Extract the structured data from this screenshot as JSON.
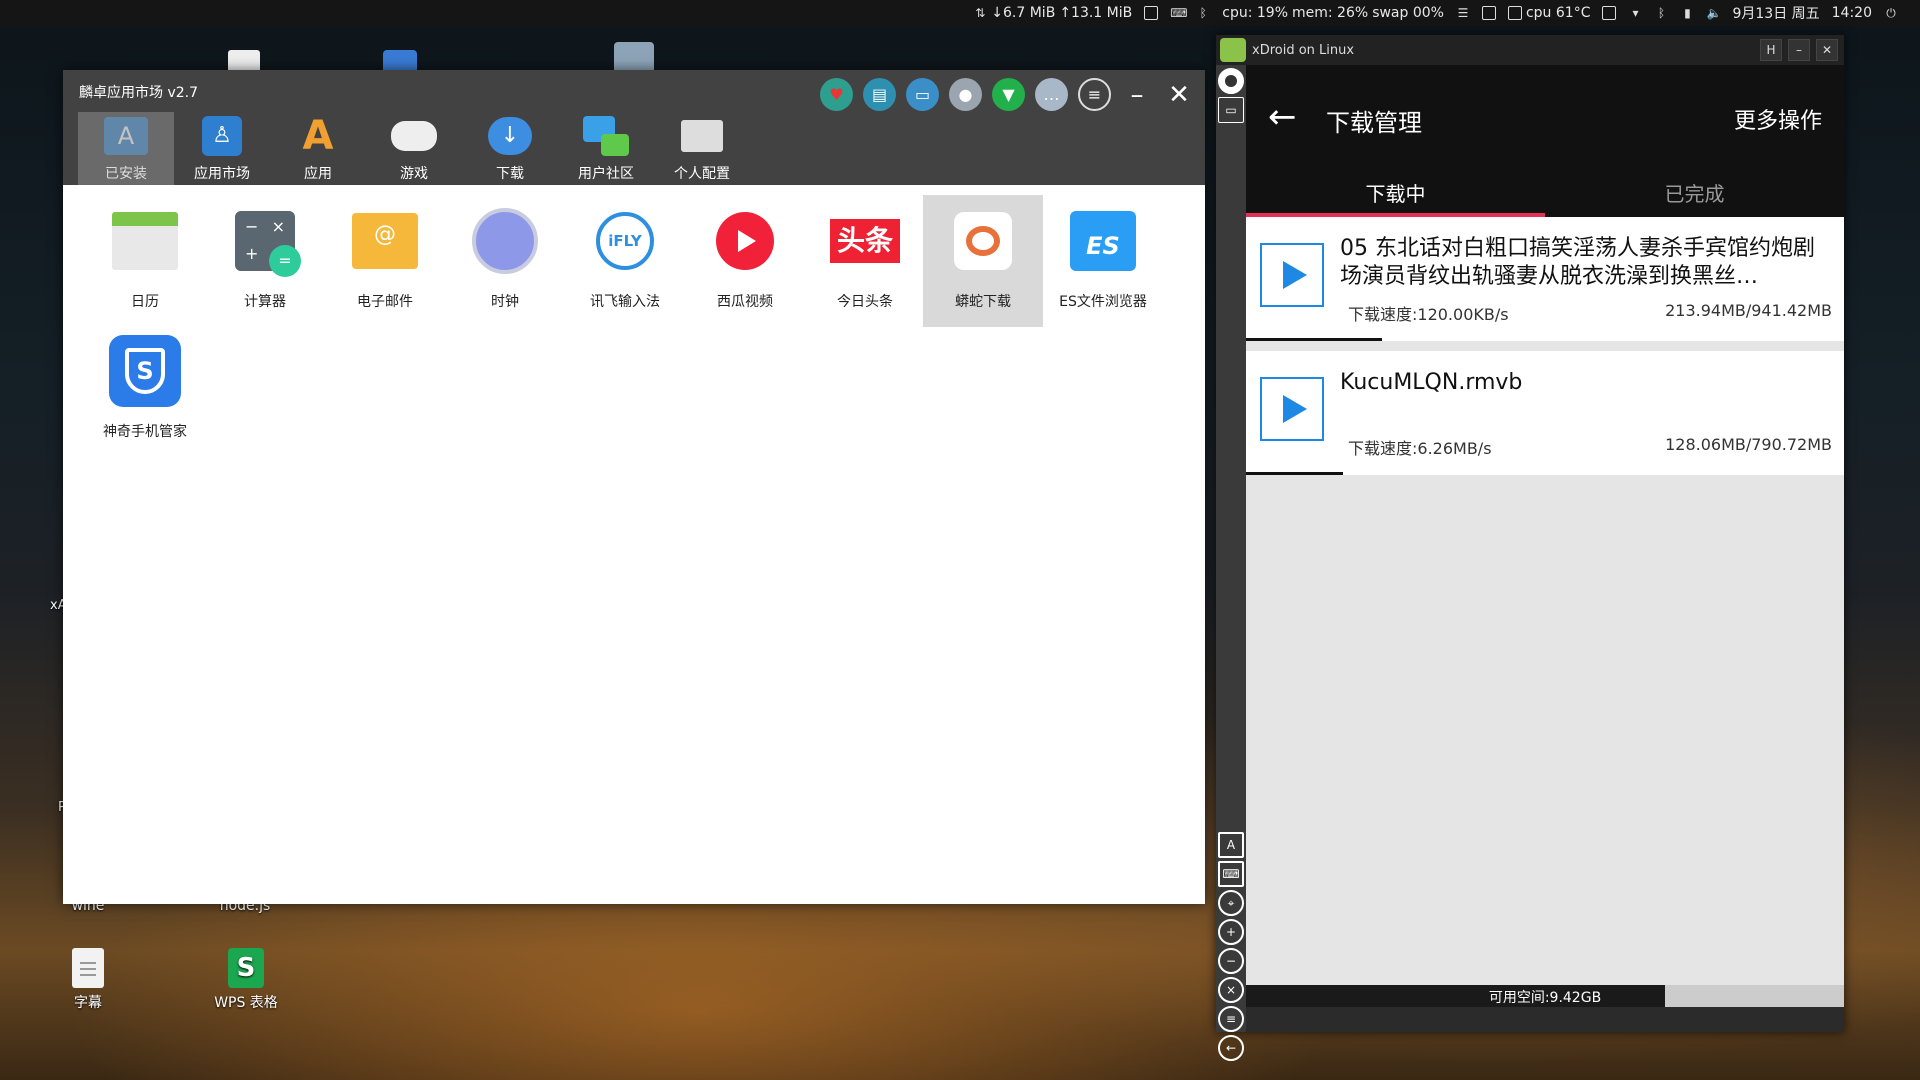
{
  "topbar": {
    "net_down": "↓6.7 MiB",
    "net_up": "↑13.1 MiB",
    "cpu": "cpu: 19%",
    "mem": "mem: 26%",
    "swap": "swap 00%",
    "temp": "cpu 61°C",
    "date": "9月13日 周五",
    "time": "14:20"
  },
  "desktop": {
    "icons": [
      {
        "label": "wine"
      },
      {
        "label": "node.js"
      },
      {
        "label": "字幕"
      },
      {
        "label": "WPS 表格"
      }
    ],
    "partial_labels": [
      "xA",
      "P"
    ]
  },
  "market": {
    "title": "麟卓应用市场  v2.7",
    "nav": [
      {
        "label": "已安装",
        "icon": "app-store-icon"
      },
      {
        "label": "应用市场",
        "icon": "linux-store-icon"
      },
      {
        "label": "应用",
        "icon": "apps-icon"
      },
      {
        "label": "游戏",
        "icon": "gamepad-icon"
      },
      {
        "label": "下载",
        "icon": "cloud-download-icon"
      },
      {
        "label": "用户社区",
        "icon": "chat-bubbles-icon"
      },
      {
        "label": "个人配置",
        "icon": "user-folder-icon"
      }
    ],
    "apps": [
      {
        "label": "日历",
        "icon": "calendar-icon"
      },
      {
        "label": "计算器",
        "icon": "calculator-icon"
      },
      {
        "label": "电子邮件",
        "icon": "email-icon"
      },
      {
        "label": "时钟",
        "icon": "clock-icon"
      },
      {
        "label": "讯飞输入法",
        "icon": "ifly-icon",
        "text": "iFLY"
      },
      {
        "label": "西瓜视频",
        "icon": "xigua-video-icon"
      },
      {
        "label": "今日头条",
        "icon": "toutiao-icon",
        "text": "头条"
      },
      {
        "label": "蟒蛇下载",
        "icon": "python-download-icon"
      },
      {
        "label": "ES文件浏览器",
        "icon": "es-file-icon"
      },
      {
        "label": "神奇手机管家",
        "icon": "phone-guard-icon"
      }
    ],
    "selected_app": "蟒蛇下载"
  },
  "xdroid": {
    "window_title": "xDroid on Linux",
    "h_button": "H",
    "header_title": "下载管理",
    "more_label": "更多操作",
    "tabs": [
      {
        "label": "下载中",
        "active": true
      },
      {
        "label": "已完成",
        "active": false
      }
    ],
    "downloads": [
      {
        "name": "05 东北话对白粗口搞笑淫荡人妻杀手宾馆约炮剧场演员背纹出轨骚妻从脱衣洗澡到换黑丝…",
        "speed": "下载速度:120.00KB/s",
        "size": "213.94MB/941.42MB",
        "progress": 0.227
      },
      {
        "name": "KucuMLQN.rmvb",
        "speed": "下载速度:6.26MB/s",
        "size": "128.06MB/790.72MB",
        "progress": 0.162
      }
    ],
    "storage": {
      "label": "可用空间:9.42GB",
      "used_fraction": 0.7
    }
  },
  "colors": {
    "accent_pink": "#e53058",
    "play_blue": "#1e88e5"
  }
}
